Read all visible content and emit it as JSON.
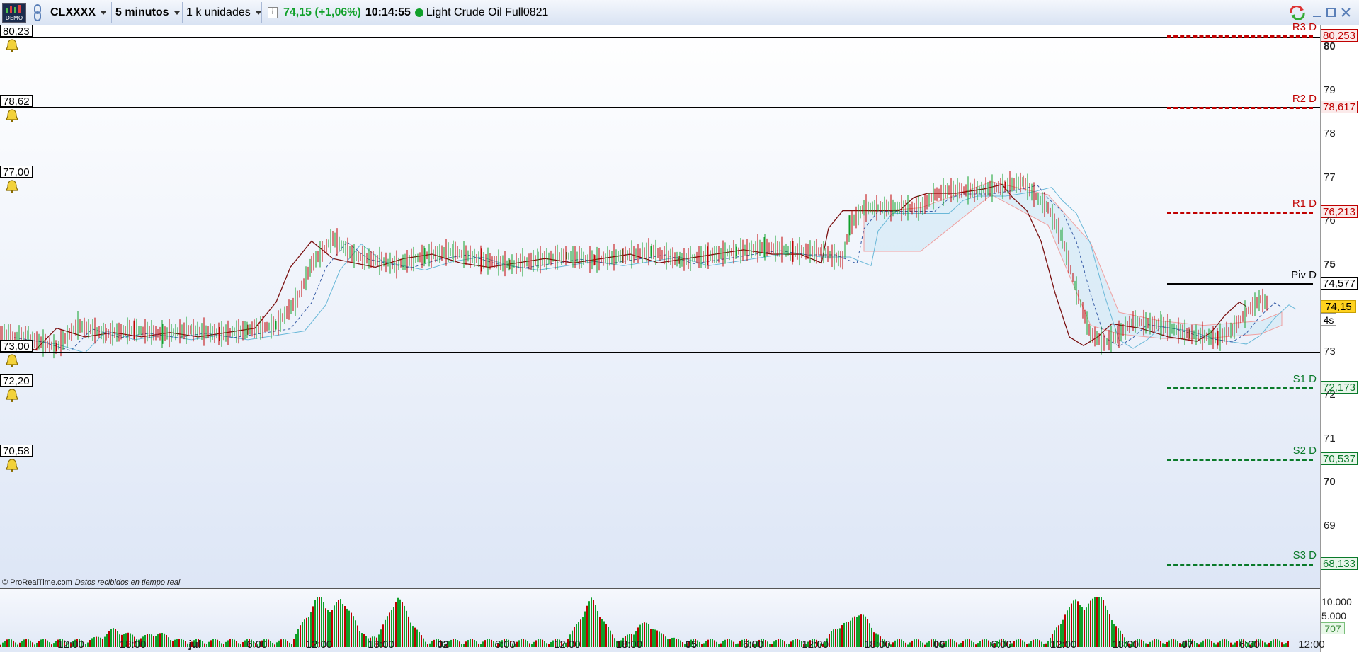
{
  "toolbar": {
    "logo_text": "DEMO",
    "symbol": "CLXXXX",
    "timeframe": "5 minutos",
    "units": "1 k unidades",
    "info_label": "i",
    "price_change": "74,15 (+1,06%)",
    "time": "10:14:55",
    "instrument_name": "Light Crude Oil Full0821"
  },
  "colors": {
    "up": "#10a02a",
    "down": "#c00000",
    "resistance": "#c00000",
    "support": "#0a7a2a",
    "current_price_bg": "#ffd21f"
  },
  "alert_lines": [
    {
      "label": "80,23",
      "value": 80.23
    },
    {
      "label": "78,62",
      "value": 78.62
    },
    {
      "label": "77,00",
      "value": 77.0
    },
    {
      "label": "73,00",
      "value": 73.0
    },
    {
      "label": "72,20",
      "value": 72.2
    },
    {
      "label": "70,58",
      "value": 70.58
    }
  ],
  "pivots": [
    {
      "name": "R3 D",
      "value_label": "80,253",
      "value": 80.253,
      "kind": "resistance"
    },
    {
      "name": "R2 D",
      "value_label": "78,617",
      "value": 78.617,
      "kind": "resistance"
    },
    {
      "name": "R1 D",
      "value_label": "76,213",
      "value": 76.213,
      "kind": "resistance"
    },
    {
      "name": "Piv D",
      "value_label": "74,577",
      "value": 74.577,
      "kind": "pivot"
    },
    {
      "name": "S1 D",
      "value_label": "72,173",
      "value": 72.173,
      "kind": "support"
    },
    {
      "name": "S2 D",
      "value_label": "70,537",
      "value": 70.537,
      "kind": "support"
    },
    {
      "name": "S3 D",
      "value_label": "68,133",
      "value": 68.133,
      "kind": "support"
    }
  ],
  "price_axis": {
    "ticks": [
      {
        "label": "80",
        "value": 80,
        "bold": true
      },
      {
        "label": "79",
        "value": 79,
        "bold": false
      },
      {
        "label": "78",
        "value": 78,
        "bold": false
      },
      {
        "label": "77",
        "value": 77,
        "bold": false
      },
      {
        "label": "76",
        "value": 76,
        "bold": false
      },
      {
        "label": "75",
        "value": 75,
        "bold": true
      },
      {
        "label": "73",
        "value": 73,
        "bold": false
      },
      {
        "label": "72",
        "value": 72,
        "bold": false
      },
      {
        "label": "71",
        "value": 71,
        "bold": false
      },
      {
        "label": "70",
        "value": 70,
        "bold": true
      },
      {
        "label": "69",
        "value": 69,
        "bold": false
      }
    ],
    "current_price": "74,15",
    "candle_timer": "4s"
  },
  "time_axis": [
    {
      "label": "12:00",
      "bold": false
    },
    {
      "label": "18:00",
      "bold": false
    },
    {
      "label": "jul",
      "bold": true
    },
    {
      "label": "6:00",
      "bold": false
    },
    {
      "label": "12:00",
      "bold": false
    },
    {
      "label": "18:00",
      "bold": false
    },
    {
      "label": "02",
      "bold": true
    },
    {
      "label": "6:00",
      "bold": false
    },
    {
      "label": "12:00",
      "bold": false
    },
    {
      "label": "18:00",
      "bold": false
    },
    {
      "label": "05",
      "bold": true
    },
    {
      "label": "6:00",
      "bold": false
    },
    {
      "label": "12:00",
      "bold": false
    },
    {
      "label": "18:00",
      "bold": false
    },
    {
      "label": "06",
      "bold": true
    },
    {
      "label": "6:00",
      "bold": false
    },
    {
      "label": "12:00",
      "bold": false
    },
    {
      "label": "18:00",
      "bold": false
    },
    {
      "label": "07",
      "bold": true
    },
    {
      "label": "6:00",
      "bold": false
    },
    {
      "label": "12:00",
      "bold": false
    }
  ],
  "volume_axis": {
    "ticks": [
      "10.000",
      "5.000"
    ],
    "current_volume": "707"
  },
  "footer": {
    "copyright": "© ProRealTime.com",
    "data_status": "Datos recibidos en tiempo real"
  },
  "chart_data": {
    "type": "line",
    "y_range": [
      68,
      80.6
    ],
    "price_path": [
      [
        0,
        73.4
      ],
      [
        40,
        73.3
      ],
      [
        80,
        73.1
      ],
      [
        110,
        73.6
      ],
      [
        150,
        73.4
      ],
      [
        190,
        73.5
      ],
      [
        230,
        73.4
      ],
      [
        270,
        73.5
      ],
      [
        310,
        73.4
      ],
      [
        350,
        73.5
      ],
      [
        390,
        73.6
      ],
      [
        420,
        74.2
      ],
      [
        440,
        75.0
      ],
      [
        470,
        75.6
      ],
      [
        500,
        75.2
      ],
      [
        530,
        75.1
      ],
      [
        560,
        75.0
      ],
      [
        600,
        75.2
      ],
      [
        640,
        75.3
      ],
      [
        680,
        75.1
      ],
      [
        720,
        75.0
      ],
      [
        760,
        75.1
      ],
      [
        800,
        75.2
      ],
      [
        840,
        75.1
      ],
      [
        880,
        75.2
      ],
      [
        920,
        75.3
      ],
      [
        960,
        75.1
      ],
      [
        1000,
        75.2
      ],
      [
        1040,
        75.3
      ],
      [
        1080,
        75.4
      ],
      [
        1120,
        75.3
      ],
      [
        1160,
        75.3
      ],
      [
        1190,
        75.1
      ],
      [
        1200,
        75.9
      ],
      [
        1220,
        76.3
      ],
      [
        1240,
        76.3
      ],
      [
        1300,
        76.3
      ],
      [
        1320,
        76.6
      ],
      [
        1340,
        76.7
      ],
      [
        1380,
        76.7
      ],
      [
        1420,
        76.8
      ],
      [
        1445,
        76.9
      ],
      [
        1460,
        76.6
      ],
      [
        1480,
        76.3
      ],
      [
        1500,
        75.6
      ],
      [
        1520,
        74.4
      ],
      [
        1540,
        73.4
      ],
      [
        1560,
        73.2
      ],
      [
        1580,
        73.4
      ],
      [
        1600,
        73.7
      ],
      [
        1640,
        73.6
      ],
      [
        1680,
        73.4
      ],
      [
        1720,
        73.3
      ],
      [
        1740,
        73.5
      ],
      [
        1760,
        73.9
      ],
      [
        1780,
        74.2
      ],
      [
        1790,
        74.1
      ]
    ],
    "ichimoku_cloud_upper": [
      [
        1220,
        76.2
      ],
      [
        1300,
        76.3
      ],
      [
        1400,
        76.9
      ],
      [
        1480,
        76.6
      ],
      [
        1540,
        75.5
      ],
      [
        1580,
        73.9
      ],
      [
        1640,
        73.7
      ],
      [
        1700,
        73.6
      ],
      [
        1780,
        73.7
      ],
      [
        1810,
        73.9
      ]
    ],
    "ichimoku_cloud_lower": [
      [
        1220,
        75.3
      ],
      [
        1300,
        75.3
      ],
      [
        1400,
        76.6
      ],
      [
        1480,
        75.9
      ],
      [
        1540,
        73.6
      ],
      [
        1580,
        73.4
      ],
      [
        1640,
        73.3
      ],
      [
        1700,
        73.3
      ],
      [
        1780,
        73.4
      ],
      [
        1810,
        73.6
      ]
    ],
    "volume_spikes": [
      [
        160,
        2.5
      ],
      [
        215,
        2.0
      ],
      [
        450,
        9.5
      ],
      [
        480,
        9.0
      ],
      [
        560,
        9.5
      ],
      [
        835,
        9.0
      ],
      [
        915,
        4.5
      ],
      [
        1205,
        8.5
      ],
      [
        1520,
        10.0
      ],
      [
        1550,
        9.5
      ]
    ]
  }
}
